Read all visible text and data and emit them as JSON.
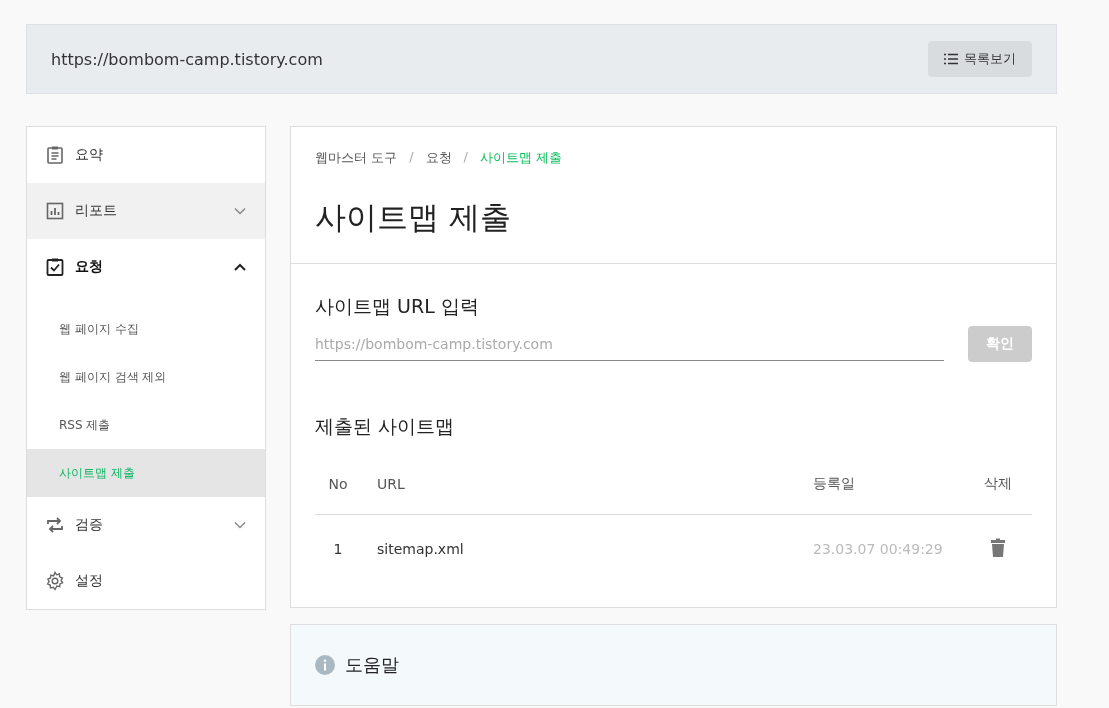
{
  "header": {
    "url": "https://bombom-camp.tistory.com",
    "list_button": "목록보기"
  },
  "sidebar": {
    "items": [
      {
        "label": "요약",
        "selected": false,
        "hovered": false
      },
      {
        "label": "리포트",
        "selected": false,
        "hovered": true,
        "expanded": false
      },
      {
        "label": "요청",
        "selected": true,
        "hovered": false,
        "expanded": true,
        "children": [
          {
            "label": "웹 페이지 수집",
            "selected": false
          },
          {
            "label": "웹 페이지 검색 제외",
            "selected": false
          },
          {
            "label": "RSS 제출",
            "selected": false
          },
          {
            "label": "사이트맵 제출",
            "selected": true
          }
        ]
      },
      {
        "label": "검증",
        "selected": false,
        "hovered": false,
        "expanded": false
      },
      {
        "label": "설정",
        "selected": false,
        "hovered": false
      }
    ]
  },
  "breadcrumb": [
    {
      "kind": "link",
      "text": "웹마스터 도구",
      "selected": false
    },
    {
      "kind": "separator",
      "text": "/"
    },
    {
      "kind": "link",
      "text": "요청",
      "selected": false
    },
    {
      "kind": "separator",
      "text": "/"
    },
    {
      "kind": "link",
      "text": "사이트맵 제출",
      "selected": true
    }
  ],
  "page_title": "사이트맵 제출",
  "url_section": {
    "title": "사이트맵 URL 입력",
    "placeholder": "https://bombom-camp.tistory.com",
    "confirm_button": "확인",
    "confirm_disabled": true
  },
  "submitted": {
    "title": "제출된 사이트맵",
    "columns": [
      "No",
      "URL",
      "등록일",
      "삭제"
    ],
    "rows": [
      {
        "no": "1",
        "url": "sitemap.xml",
        "date": "23.03.07 00:49:29"
      }
    ]
  },
  "help": {
    "title": "도움말"
  }
}
